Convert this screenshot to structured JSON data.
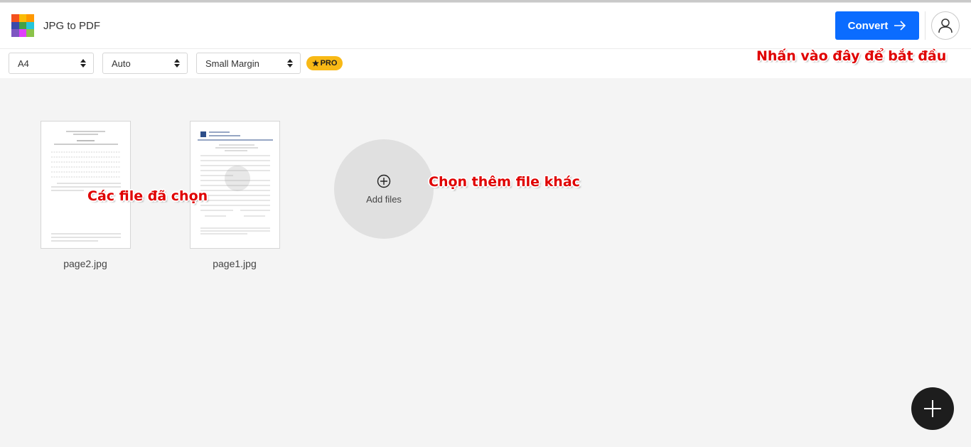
{
  "app": {
    "title": "JPG to PDF"
  },
  "header": {
    "convert_label": "Convert"
  },
  "toolbar": {
    "page_size": "A4",
    "orientation": "Auto",
    "margin": "Small Margin",
    "pro_label": "PRO"
  },
  "files": [
    {
      "name": "page2.jpg"
    },
    {
      "name": "page1.jpg"
    }
  ],
  "add_files": {
    "label": "Add files"
  },
  "annotations": {
    "start_here": "Nhấn vào đây để bắt đầu",
    "selected_files": "Các file đã chọn",
    "choose_more": "Chọn thêm file khác"
  },
  "colors": {
    "accent": "#0b6cff",
    "pro_badge": "#f8b916",
    "annotation": "#e00000",
    "fab": "#1d1d1d"
  },
  "icons": {
    "logo": "colorful-grid-logo",
    "convert": "arrow-right-icon",
    "account": "user-icon",
    "add_files": "plus-circle-icon",
    "fab": "plus-icon",
    "pro": "star-icon"
  }
}
